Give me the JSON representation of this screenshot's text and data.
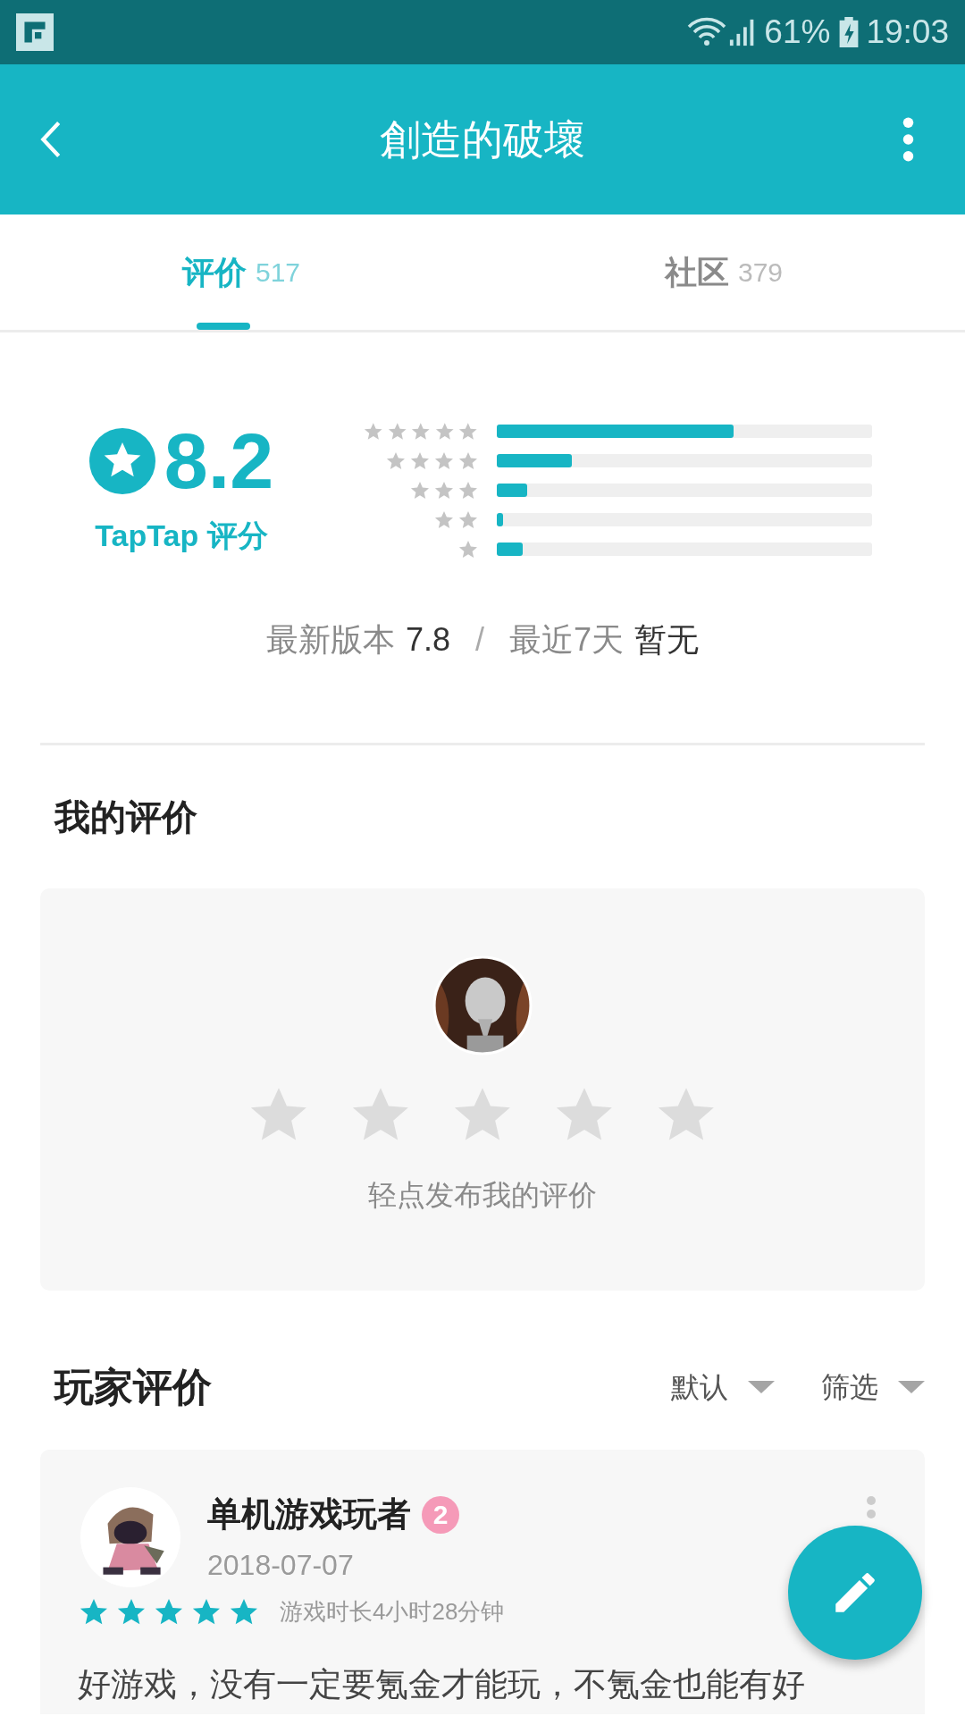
{
  "status_bar": {
    "battery": "61%",
    "time": "19:03"
  },
  "app_bar": {
    "title": "創造的破壞"
  },
  "tabs": [
    {
      "label": "评价",
      "count": "517",
      "selected": true
    },
    {
      "label": "社区",
      "count": "379",
      "selected": false
    }
  ],
  "rating": {
    "score": "8.2",
    "brand": "TapTap 评分",
    "distribution": [
      {
        "level": 0.63
      },
      {
        "level": 0.2
      },
      {
        "level": 0.08
      },
      {
        "level": 0.016
      },
      {
        "level": 0.07
      }
    ],
    "latest_label": "最新版本",
    "latest_value": "7.8",
    "separator": "/",
    "recent_label": "最近7天",
    "recent_value": "暂无"
  },
  "my_review": {
    "heading": "我的评价",
    "stars": 0,
    "hint": "轻点发布我的评价"
  },
  "player_reviews": {
    "heading": "玩家评价",
    "sort": "默认",
    "filter": "筛选",
    "items": [
      {
        "author": "单机游戏玩者",
        "level": "2",
        "date": "2018-07-07",
        "stars": 5,
        "playtime": "游戏时长4小时28分钟",
        "text": "好游戏，没有一定要氪金才能玩，不氪金也能有好"
      }
    ]
  }
}
